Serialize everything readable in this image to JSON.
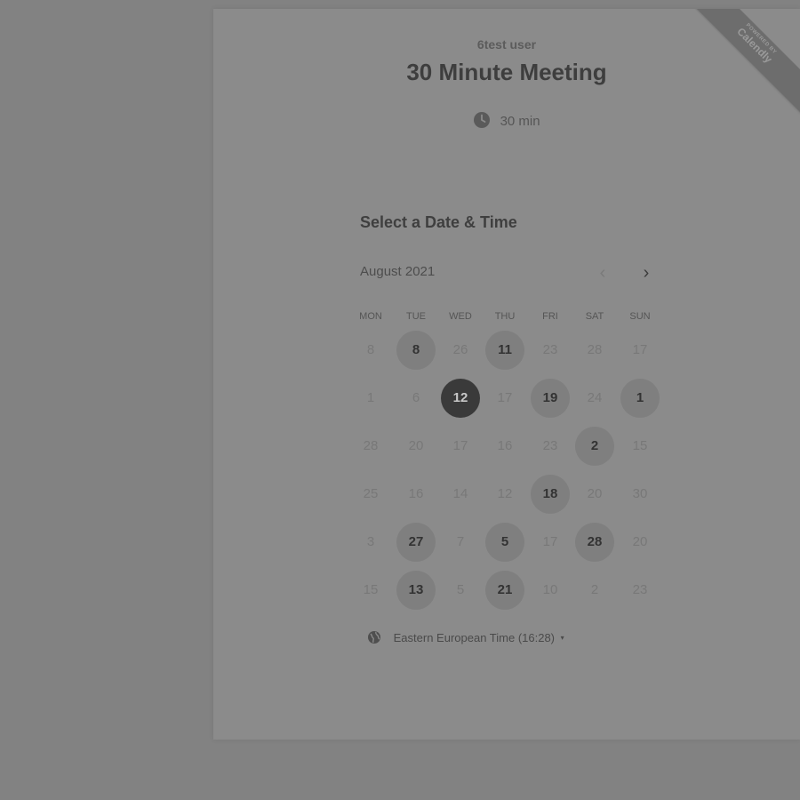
{
  "organizer_name": "6test user",
  "event_title": "30 Minute Meeting",
  "duration": {
    "icon": "clock-icon",
    "label": "30 min"
  },
  "ribbon": {
    "line1": "POWERED BY",
    "line2": "Calendly"
  },
  "heading": "Select a Date & Time",
  "calendar": {
    "month_label": "August 2021",
    "prev_icon": "chevron-left-icon",
    "next_icon": "chevron-right-icon",
    "weekdays": [
      "MON",
      "TUE",
      "WED",
      "THU",
      "FRI",
      "SAT",
      "SUN"
    ],
    "weeks": [
      [
        {
          "d": "8",
          "s": "na"
        },
        {
          "d": "8",
          "s": "available"
        },
        {
          "d": "26",
          "s": "na"
        },
        {
          "d": "11",
          "s": "available"
        },
        {
          "d": "23",
          "s": "na"
        },
        {
          "d": "28",
          "s": "na"
        },
        {
          "d": "17",
          "s": "na"
        }
      ],
      [
        {
          "d": "1",
          "s": "na"
        },
        {
          "d": "6",
          "s": "na"
        },
        {
          "d": "12",
          "s": "selected"
        },
        {
          "d": "17",
          "s": "na"
        },
        {
          "d": "19",
          "s": "available"
        },
        {
          "d": "24",
          "s": "na"
        },
        {
          "d": "1",
          "s": "available"
        }
      ],
      [
        {
          "d": "28",
          "s": "na"
        },
        {
          "d": "20",
          "s": "na"
        },
        {
          "d": "17",
          "s": "na"
        },
        {
          "d": "16",
          "s": "na"
        },
        {
          "d": "23",
          "s": "na"
        },
        {
          "d": "2",
          "s": "available"
        },
        {
          "d": "15",
          "s": "na"
        }
      ],
      [
        {
          "d": "25",
          "s": "na"
        },
        {
          "d": "16",
          "s": "na"
        },
        {
          "d": "14",
          "s": "na"
        },
        {
          "d": "12",
          "s": "na"
        },
        {
          "d": "18",
          "s": "available"
        },
        {
          "d": "20",
          "s": "na"
        },
        {
          "d": "30",
          "s": "na"
        }
      ],
      [
        {
          "d": "3",
          "s": "na"
        },
        {
          "d": "27",
          "s": "available"
        },
        {
          "d": "7",
          "s": "na"
        },
        {
          "d": "5",
          "s": "available"
        },
        {
          "d": "17",
          "s": "na"
        },
        {
          "d": "28",
          "s": "available"
        },
        {
          "d": "20",
          "s": "na"
        }
      ],
      [
        {
          "d": "15",
          "s": "na"
        },
        {
          "d": "13",
          "s": "available"
        },
        {
          "d": "5",
          "s": "na"
        },
        {
          "d": "21",
          "s": "available"
        },
        {
          "d": "10",
          "s": "na"
        },
        {
          "d": "2",
          "s": "na"
        },
        {
          "d": "23",
          "s": "na"
        }
      ]
    ]
  },
  "timezone": {
    "icon": "globe-icon",
    "label": "Eastern European Time (16:28)",
    "caret": "▾"
  }
}
